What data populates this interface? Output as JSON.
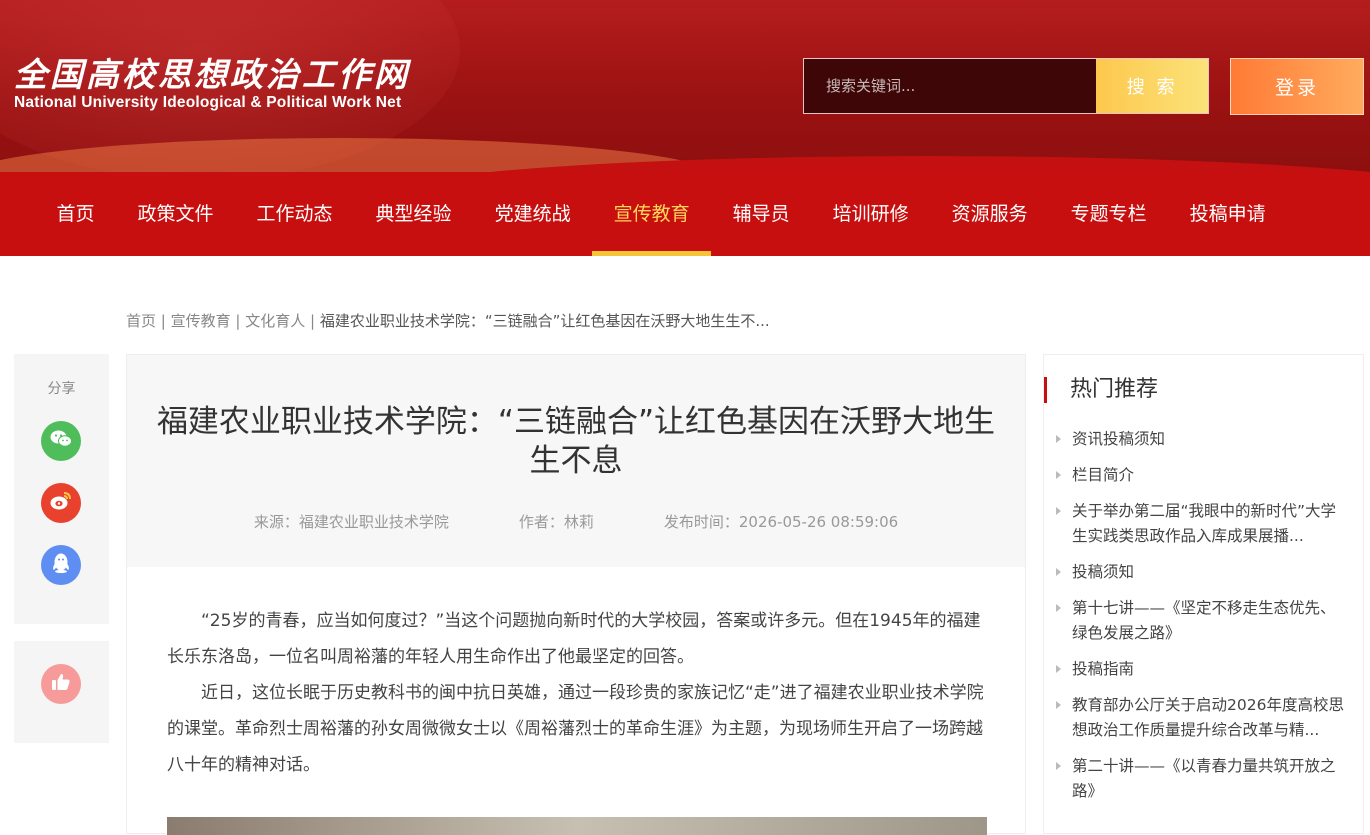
{
  "header": {
    "logo_cn": "全国高校思想政治工作网",
    "logo_en": "National University Ideological & Political Work Net",
    "search_placeholder": "搜索关键词...",
    "search_button": "搜 索",
    "login_button": "登录"
  },
  "nav": {
    "items": [
      {
        "label": "首页"
      },
      {
        "label": "政策文件"
      },
      {
        "label": "工作动态"
      },
      {
        "label": "典型经验"
      },
      {
        "label": "党建统战"
      },
      {
        "label": "宣传教育"
      },
      {
        "label": "辅导员"
      },
      {
        "label": "培训研修"
      },
      {
        "label": "资源服务"
      },
      {
        "label": "专题专栏"
      },
      {
        "label": "投稿申请"
      }
    ],
    "active": "宣传教育"
  },
  "breadcrumb": {
    "home": "首页",
    "sep": " | ",
    "section": "宣传教育",
    "subsection": "文化育人",
    "current": "福建农业职业技术学院：“三链融合”让红色基因在沃野大地生生不..."
  },
  "share": {
    "label": "分享",
    "icons": [
      "wechat-icon",
      "weibo-icon",
      "qq-icon"
    ],
    "like_icon": "thumbs-up-icon"
  },
  "article": {
    "title": "福建农业职业技术学院：“三链融合”让红色基因在沃野大地生生不息",
    "source": "来源：福建农业职业技术学院",
    "author": "作者：林莉",
    "date": "发布时间：2026-05-26 08:59:06",
    "paragraphs": [
      "“25岁的青春，应当如何度过？”当这个问题抛向新时代的大学校园，答案或许多元。但在1945年的福建长乐东洛岛，一位名叫周裕藩的年轻人用生命作出了他最坚定的回答。",
      "近日，这位长眠于历史教科书的闽中抗日英雄，通过一段珍贵的家族记忆“走”进了福建农业职业技术学院的课堂。革命烈士周裕藩的孙女周微微女士以《周裕藩烈士的革命生涯》为主题，为现场师生开启了一场跨越八十年的精神对话。"
    ]
  },
  "sidebar": {
    "title": "热门推荐",
    "items": [
      "资讯投稿须知",
      "栏目简介",
      "关于举办第二届“我眼中的新时代”大学生实践类思政作品入库成果展播...",
      "投稿须知",
      "第十七讲——《坚定不移走生态优先、绿色发展之路》",
      "投稿指南",
      "教育部办公厅关于启动2026年度高校思想政治工作质量提升综合改革与精...",
      "第二十讲——《以青春力量共筑开放之路》"
    ]
  },
  "colors": {
    "header_red": "#9c1212",
    "nav_red": "#c80f0f",
    "active_gold": "#ffd55c",
    "search_button": "#fdc84d",
    "login_button": "#ff8a40"
  }
}
